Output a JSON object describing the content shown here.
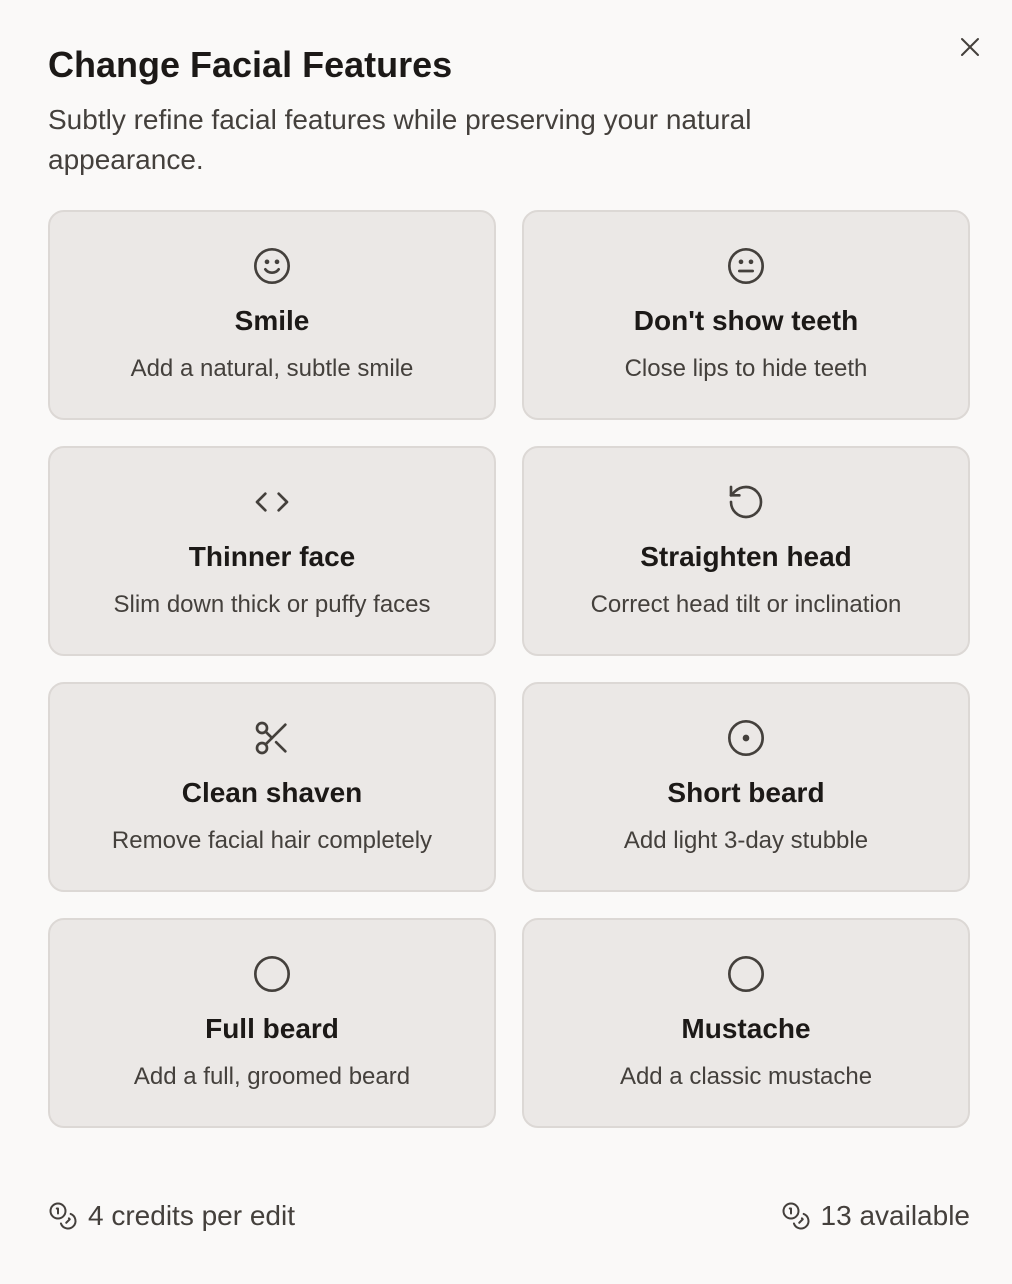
{
  "dialog": {
    "title": "Change Facial Features",
    "subtitle": "Subtly refine facial features while preserving your natural appearance.",
    "close_icon": "close-icon"
  },
  "options": [
    {
      "icon": "smile-icon",
      "title": "Smile",
      "description": "Add a natural, subtle smile"
    },
    {
      "icon": "neutral-face-icon",
      "title": "Don't show teeth",
      "description": "Close lips to hide teeth"
    },
    {
      "icon": "code-brackets-icon",
      "title": "Thinner face",
      "description": "Slim down thick or puffy faces"
    },
    {
      "icon": "rotate-ccw-icon",
      "title": "Straighten head",
      "description": "Correct head tilt or inclination"
    },
    {
      "icon": "scissors-icon",
      "title": "Clean shaven",
      "description": "Remove facial hair completely"
    },
    {
      "icon": "circle-dot-icon",
      "title": "Short beard",
      "description": "Add light 3-day stubble"
    },
    {
      "icon": "circle-icon",
      "title": "Full beard",
      "description": "Add a full, groomed beard"
    },
    {
      "icon": "circle-icon",
      "title": "Mustache",
      "description": "Add a classic mustache"
    }
  ],
  "footer": {
    "cost_icon": "coins-icon",
    "cost_label": "4 credits per edit",
    "balance_icon": "coins-icon",
    "balance_label": "13 available"
  },
  "colors": {
    "background": "#faf9f8",
    "card_background": "#ebe8e6",
    "card_border": "#dcd8d5",
    "text_primary": "#1c1917",
    "text_secondary": "#44403c",
    "icon": "#44403c"
  }
}
